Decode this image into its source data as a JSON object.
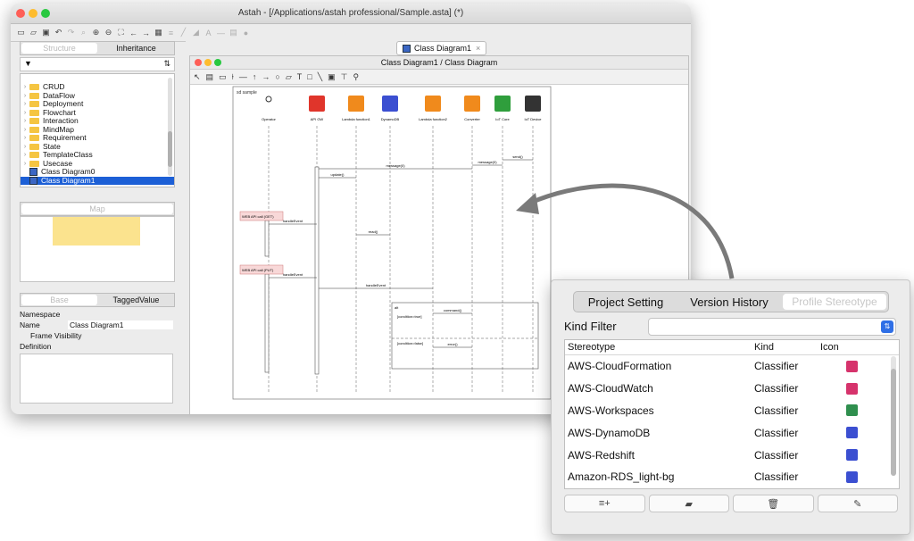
{
  "window": {
    "title": "Astah - [/Applications/astah professional/Sample.asta] (*)"
  },
  "left_panel": {
    "top_tabs": [
      "Structure",
      "Inheritance"
    ],
    "tree": [
      {
        "label": "CRUD",
        "type": "folder"
      },
      {
        "label": "DataFlow",
        "type": "folder"
      },
      {
        "label": "Deployment",
        "type": "folder"
      },
      {
        "label": "Flowchart",
        "type": "folder"
      },
      {
        "label": "Interaction",
        "type": "folder"
      },
      {
        "label": "MindMap",
        "type": "folder"
      },
      {
        "label": "Requirement",
        "type": "folder"
      },
      {
        "label": "State",
        "type": "folder"
      },
      {
        "label": "TemplateClass",
        "type": "folder"
      },
      {
        "label": "Usecase",
        "type": "folder"
      },
      {
        "label": "Class Diagram0",
        "type": "diagram"
      },
      {
        "label": "Class Diagram1",
        "type": "diagram",
        "selected": true
      }
    ],
    "map_tab": "Map",
    "bottom_tabs": [
      "Base",
      "TaggedValue"
    ],
    "props": {
      "namespace_label": "Namespace",
      "name_label": "Name",
      "name_value": "Class Diagram1",
      "frame_visibility": "Frame Visibility",
      "definition_label": "Definition"
    }
  },
  "main": {
    "doc_tab": "Class Diagram1",
    "inner_title": "Class Diagram1 / Class Diagram",
    "frame_label": "sd sample",
    "lifelines": [
      "Operator",
      "API GW",
      "Lambda function1",
      "DynamoDB",
      "Lambda function2",
      "Converter",
      "IoT Core",
      "IoT Device"
    ],
    "messages": [
      "message(0)",
      "send()",
      "message(0)",
      "update()",
      "handleEvent",
      "read()",
      "handleEvent",
      "handleEvent",
      "command()",
      "error()"
    ],
    "notes": [
      "WEB API call (GET)",
      "WEB API call (PUT)"
    ],
    "alt": {
      "label": "alt",
      "cond1": "[condition=true]",
      "cond2": "[condition=false]"
    }
  },
  "panel": {
    "tabs": [
      "Project Setting",
      "Version History",
      "Profile Stereotype"
    ],
    "selected_tab": "Profile Stereotype",
    "kind_filter_label": "Kind Filter",
    "kind_filter_value": "",
    "columns": [
      "Stereotype",
      "Kind",
      "Icon"
    ],
    "rows": [
      {
        "stereotype": "AWS-CloudFormation",
        "kind": "Classifier",
        "icon_color": "#d6336c"
      },
      {
        "stereotype": "AWS-CloudWatch",
        "kind": "Classifier",
        "icon_color": "#d6336c"
      },
      {
        "stereotype": "AWS-Workspaces",
        "kind": "Classifier",
        "icon_color": "#2f8f4e"
      },
      {
        "stereotype": "AWS-DynamoDB",
        "kind": "Classifier",
        "icon_color": "#3b4fd1"
      },
      {
        "stereotype": "AWS-Redshift",
        "kind": "Classifier",
        "icon_color": "#3b4fd1"
      },
      {
        "stereotype": "Amazon-RDS_light-bg",
        "kind": "Classifier",
        "icon_color": "#3b4fd1"
      }
    ],
    "buttons": [
      "add-icon",
      "folder-icon",
      "trash-icon",
      "pen-icon"
    ]
  },
  "colors": {
    "accent": "#1c5fd6",
    "arrow": "#7a7a7a"
  }
}
